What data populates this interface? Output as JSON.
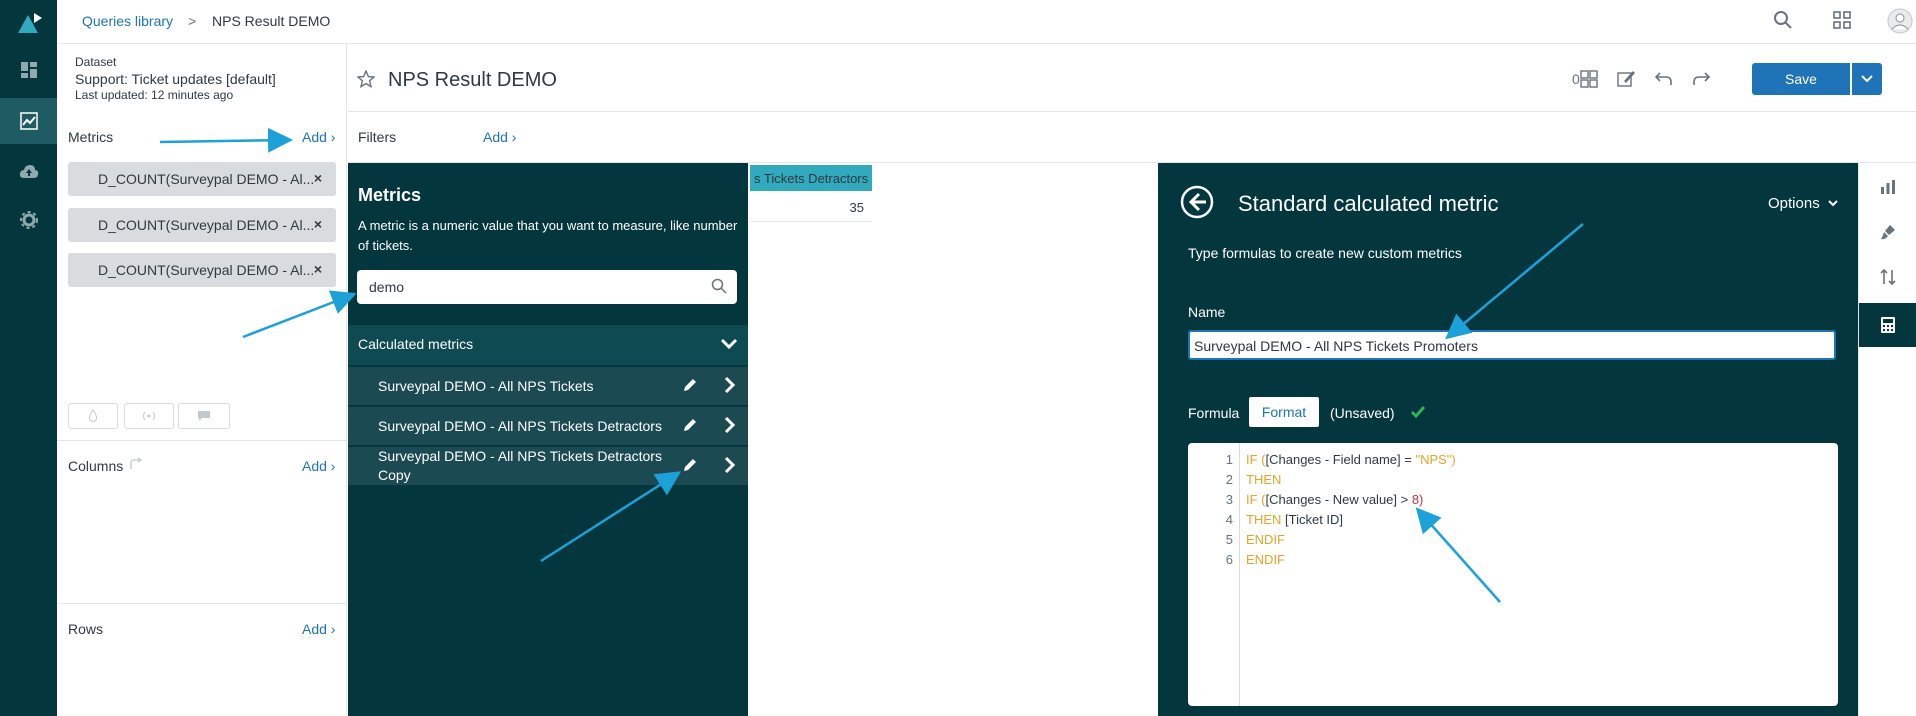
{
  "breadcrumb": {
    "library": "Queries library",
    "separator": ">",
    "current": "NPS Result DEMO"
  },
  "dataset": {
    "label": "Dataset",
    "name": "Support: Ticket updates [default]",
    "updated": "Last updated: 12 minutes ago"
  },
  "metrics_section": {
    "label": "Metrics",
    "add": "Add ›",
    "chips": [
      "D_COUNT(Surveypal DEMO - Al...",
      "D_COUNT(Surveypal DEMO - Al...",
      "D_COUNT(Surveypal DEMO - Al..."
    ],
    "remove": "×"
  },
  "columns_section": {
    "label": "Columns",
    "add": "Add ›"
  },
  "rows_section": {
    "label": "Rows",
    "add": "Add ›"
  },
  "query": {
    "title": "NPS Result DEMO",
    "counter": "0",
    "save": "Save"
  },
  "filters": {
    "label": "Filters",
    "add": "Add ›"
  },
  "metrics_panel": {
    "title": "Metrics",
    "description": "A metric is a numeric value that you want to measure, like number of tickets.",
    "search_value": "demo",
    "group": "Calculated metrics",
    "items": [
      "Surveypal DEMO - All NPS Tickets",
      "Surveypal DEMO - All NPS Tickets Detractors",
      "Surveypal DEMO - All NPS Tickets Detractors Copy"
    ]
  },
  "result": {
    "header": "s Tickets Detractors",
    "value": "35"
  },
  "calc_metric": {
    "title": "Standard calculated metric",
    "options": "Options",
    "subtitle": "Type formulas to create new custom metrics",
    "name_label": "Name",
    "name_value": "Surveypal DEMO - All NPS Tickets Promoters",
    "formula_label": "Formula",
    "format": "Format",
    "unsaved": "(Unsaved)",
    "code_lines": [
      {
        "n": "1",
        "a": "IF (",
        "b": "[Changes - Field name] = ",
        "c": "\"NPS\")"
      },
      {
        "n": "2",
        "a": "THEN",
        "b": "",
        "c": ""
      },
      {
        "n": "3",
        "a": "IF (",
        "b": "[Changes - New value] > ",
        "c": "8)"
      },
      {
        "n": "4",
        "a": "THEN ",
        "b": "[Ticket ID]",
        "c": ""
      },
      {
        "n": "5",
        "a": "ENDIF",
        "b": "",
        "c": ""
      },
      {
        "n": "6",
        "a": "ENDIF",
        "b": "",
        "c": ""
      }
    ]
  },
  "colors": {
    "nav": "#03363d",
    "accent": "#1f73b7",
    "teal": "#30aabc",
    "arrow": "#1da1d9",
    "check": "#2fb35a"
  }
}
